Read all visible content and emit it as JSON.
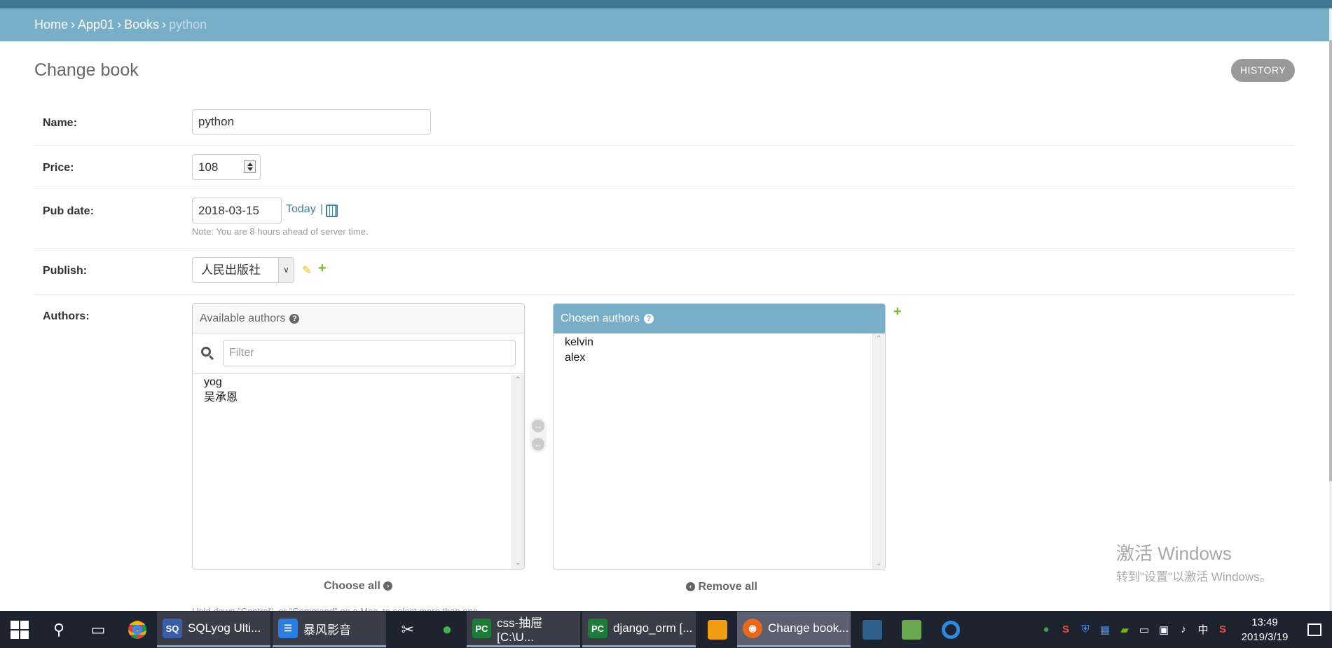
{
  "breadcrumb": {
    "items": [
      {
        "label": "Home"
      },
      {
        "label": "App01"
      },
      {
        "label": "Books"
      }
    ],
    "separator": "›",
    "current": "python"
  },
  "page": {
    "title": "Change book",
    "history_button": "HISTORY"
  },
  "form": {
    "name": {
      "label": "Name:",
      "value": "python"
    },
    "price": {
      "label": "Price:",
      "value": "108"
    },
    "pub_date": {
      "label": "Pub date:",
      "value": "2018-03-15",
      "today_link": "Today",
      "divider": "|",
      "note": "Note: You are 8 hours ahead of server time."
    },
    "publish": {
      "label": "Publish:",
      "selected": "人民出版社"
    },
    "authors": {
      "label": "Authors:",
      "available_title": "Available authors",
      "help_glyph": "?",
      "filter_placeholder": "Filter",
      "available": [
        "yog",
        "吴承恩"
      ],
      "chosen_title": "Chosen authors",
      "chosen": [
        "kelvin",
        "alex"
      ],
      "choose_all": "Choose all",
      "remove_all": "Remove all",
      "help_text": "Hold down \"Control\", or \"Command\" on a Mac, to select more than one."
    }
  },
  "watermark": {
    "line1": "激活 Windows",
    "line2": "转到\"设置\"以激活 Windows。"
  },
  "taskbar": {
    "apps": [
      {
        "label": "SQLyog Ulti...",
        "icon_text": "SQ",
        "color": "#3b5ea8"
      },
      {
        "label": "暴风影音",
        "icon_text": "☰",
        "color": "#2a7de1"
      },
      {
        "label": "css-抽屉 [C:\\U...",
        "icon_text": "PC",
        "color": "#1e7b3a"
      },
      {
        "label": "django_orm [...",
        "icon_text": "PC",
        "color": "#1e7b3a"
      },
      {
        "label": "Change book...",
        "icon_text": "◉",
        "color": "#e8691e"
      }
    ],
    "clock_time": "13:49",
    "clock_date": "2019/3/19",
    "ime": "中",
    "accent_color": "#79aec8",
    "header_color": "#417690"
  }
}
